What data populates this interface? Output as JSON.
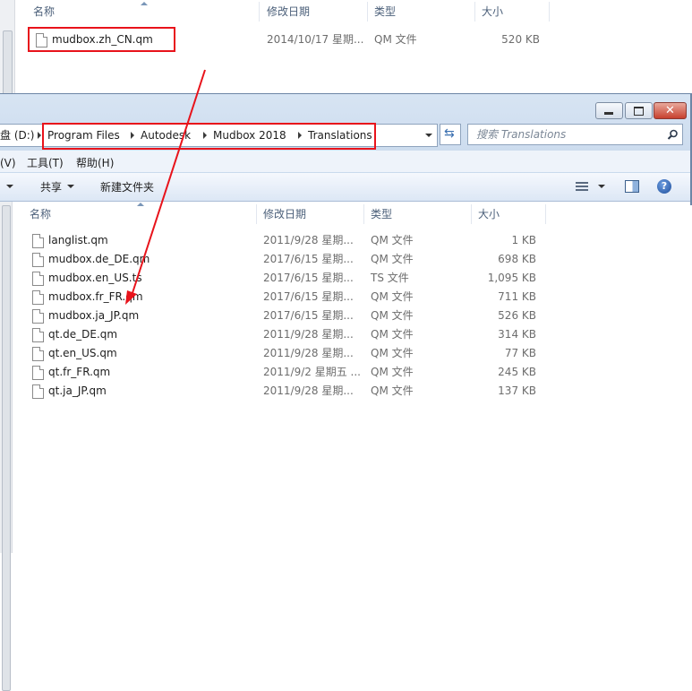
{
  "top_window": {
    "headers": {
      "name": "名称",
      "modified": "修改日期",
      "type": "类型",
      "size": "大小"
    },
    "file": {
      "name": "mudbox.zh_CN.qm",
      "modified": "2014/10/17 星期...",
      "type": "QM 文件",
      "size": "520 KB"
    }
  },
  "explorer": {
    "address": {
      "drive": "盘 (D:)",
      "crumbs": [
        "Program Files",
        "Autodesk",
        "Mudbox 2018",
        "Translations"
      ]
    },
    "search": {
      "placeholder": "搜索 Translations"
    },
    "menu": {
      "view": "(V)",
      "tools": "工具(T)",
      "help": "帮助(H)"
    },
    "toolbar": {
      "share": "共享",
      "new_folder": "新建文件夹"
    },
    "headers": {
      "name": "名称",
      "modified": "修改日期",
      "type": "类型",
      "size": "大小"
    },
    "files": [
      {
        "name": "langlist.qm",
        "modified": "2011/9/28 星期...",
        "type": "QM 文件",
        "size": "1 KB"
      },
      {
        "name": "mudbox.de_DE.qm",
        "modified": "2017/6/15 星期...",
        "type": "QM 文件",
        "size": "698 KB"
      },
      {
        "name": "mudbox.en_US.ts",
        "modified": "2017/6/15 星期...",
        "type": "TS 文件",
        "size": "1,095 KB"
      },
      {
        "name": "mudbox.fr_FR.qm",
        "modified": "2017/6/15 星期...",
        "type": "QM 文件",
        "size": "711 KB"
      },
      {
        "name": "mudbox.ja_JP.qm",
        "modified": "2017/6/15 星期...",
        "type": "QM 文件",
        "size": "526 KB"
      },
      {
        "name": "qt.de_DE.qm",
        "modified": "2011/9/28 星期...",
        "type": "QM 文件",
        "size": "314 KB"
      },
      {
        "name": "qt.en_US.qm",
        "modified": "2011/9/28 星期...",
        "type": "QM 文件",
        "size": "77 KB"
      },
      {
        "name": "qt.fr_FR.qm",
        "modified": "2011/9/2 星期五 ...",
        "type": "QM 文件",
        "size": "245 KB"
      },
      {
        "name": "qt.ja_JP.qm",
        "modified": "2011/9/28 星期...",
        "type": "QM 文件",
        "size": "137 KB"
      }
    ]
  },
  "annotation": {
    "color": "#e8131b"
  }
}
